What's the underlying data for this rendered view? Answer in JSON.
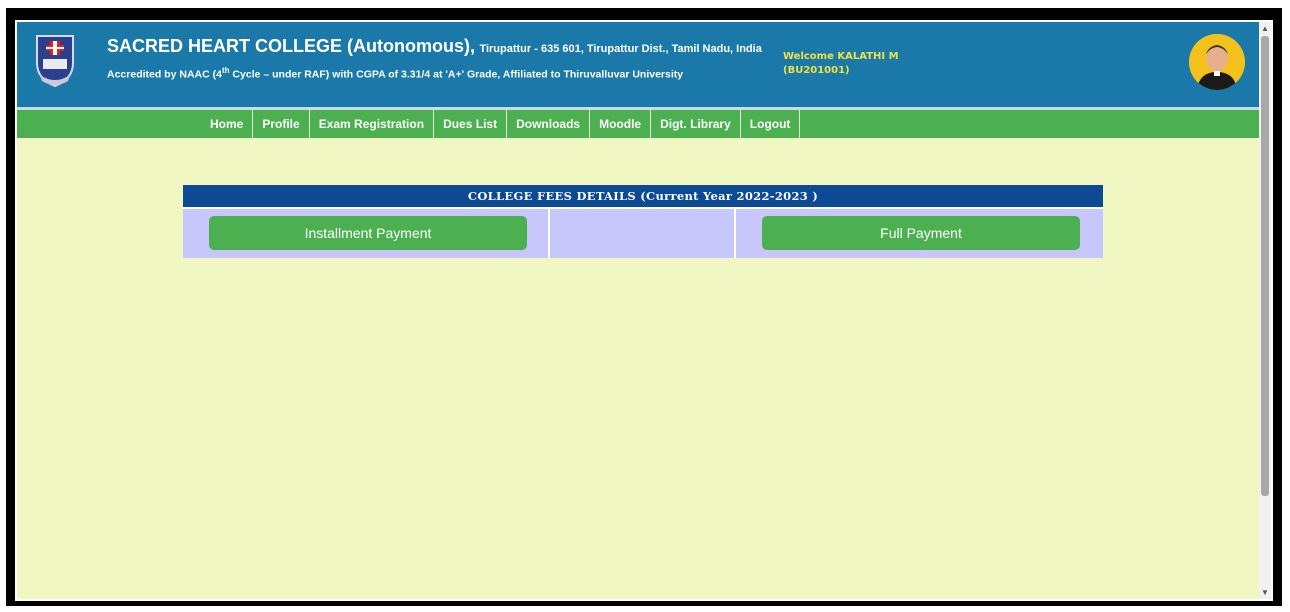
{
  "header": {
    "college_name": "SACRED HEART COLLEGE (Autonomous),",
    "address": "Tirupattur - 635 601, Tirupattur Dist., Tamil Nadu, India",
    "accreditation_pre": "Accredited by NAAC (4",
    "accreditation_sup": "th",
    "accreditation_post": " Cycle – under RAF) with CGPA of 3.31/4 at 'A+' Grade, Affiliated to Thiruvalluvar University",
    "welcome": "Welcome  KALATHI M",
    "user_id": "(BU201001)"
  },
  "nav": {
    "items": [
      "Home",
      "Profile",
      "Exam Registration",
      "Dues List",
      "Downloads",
      "Moodle",
      "Digt. Library",
      "Logout"
    ]
  },
  "fees": {
    "title": "COLLEGE FEES DETAILS (Current Year 2022-2023 )",
    "installment_label": "Installment Payment",
    "full_label": "Full Payment"
  },
  "colors": {
    "header_bg": "#1a79a8",
    "nav_bg": "#4caf50",
    "page_bg": "#f0f7c2",
    "table_head_bg": "#0d4a94",
    "table_row_bg": "#c7c7fb",
    "welcome_text": "#f5e040"
  },
  "icons": {
    "logo": "college-crest-icon",
    "avatar": "user-avatar-icon"
  }
}
